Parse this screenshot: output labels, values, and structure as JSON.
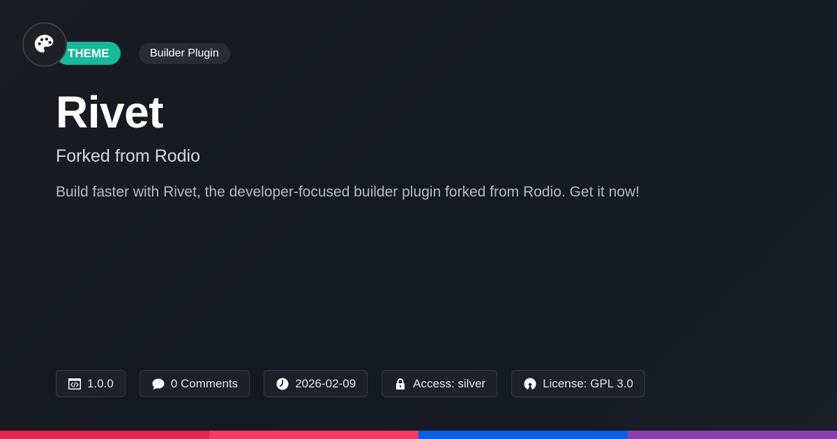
{
  "header": {
    "logo_icon": "palette-icon",
    "theme_badge": "THEME",
    "type_badge": "Builder Plugin"
  },
  "main": {
    "title": "Rivet",
    "subtitle": "Forked from Rodio",
    "description": "Build faster with Rivet, the developer-focused builder plugin forked from Rodio. Get it now!"
  },
  "meta": {
    "version": {
      "icon": "code-window-icon",
      "label": "1.0.0"
    },
    "comments": {
      "icon": "comment-icon",
      "label": "0 Comments"
    },
    "date": {
      "icon": "clock-icon",
      "label": "2026-02-09"
    },
    "access": {
      "icon": "lock-icon",
      "label": "Access: silver"
    },
    "license": {
      "icon": "open-source-icon",
      "label": "License: GPL 3.0"
    }
  },
  "colors": {
    "accent": "#17b89c",
    "stripe": [
      "#e0284f",
      "#f23a62",
      "#0c5fe0",
      "#8a3fad"
    ]
  }
}
